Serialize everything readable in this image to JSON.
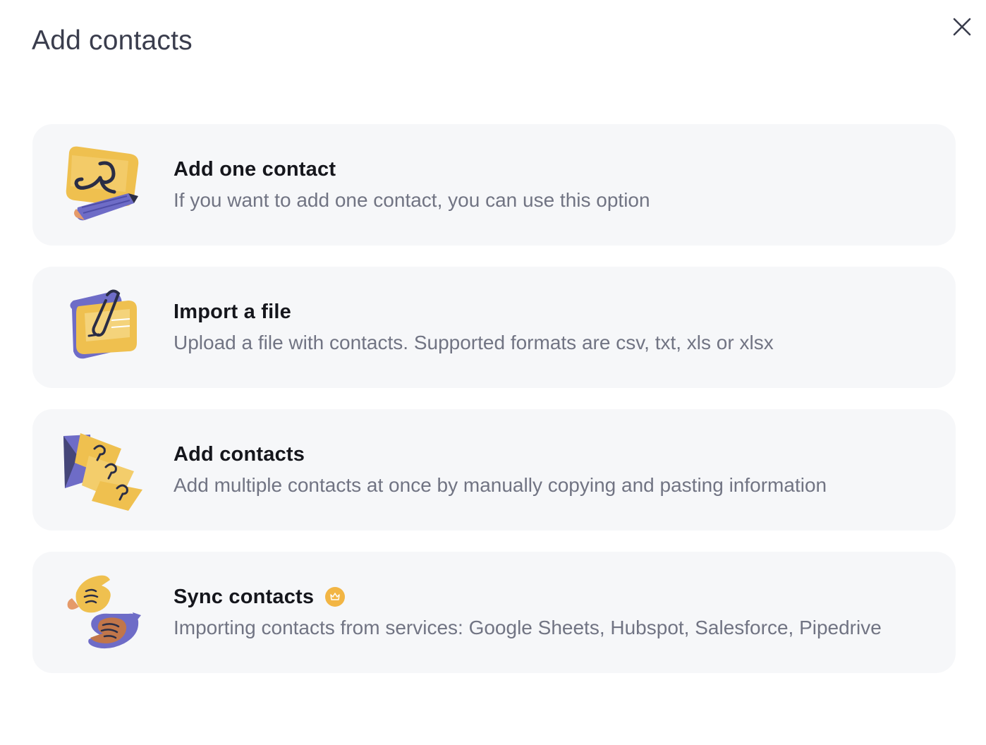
{
  "modal": {
    "title": "Add contacts",
    "close_icon": "close-icon"
  },
  "options": [
    {
      "title": "Add one contact",
      "description": "If you want to add one contact, you can use this option",
      "icon": "single-contact-pencil-icon"
    },
    {
      "title": "Import a file",
      "description": "Upload a file with contacts. Supported formats are csv, txt, xls or xlsx",
      "icon": "file-paperclip-icon"
    },
    {
      "title": "Add contacts",
      "description": "Add multiple contacts at once by manually copying and pasting information",
      "icon": "multiple-contacts-cards-icon"
    },
    {
      "title": "Sync contacts",
      "description": "Importing contacts from services: Google Sheets, Hubspot, Salesforce, Pipedrive",
      "icon": "sync-hands-icon",
      "badge_icon": "crown-icon"
    }
  ],
  "colors": {
    "card_background": "#f6f7f9",
    "title_text": "#15161c",
    "description_text": "#717483",
    "accent_yellow": "#f2b544",
    "accent_purple": "#6e6cc7"
  }
}
